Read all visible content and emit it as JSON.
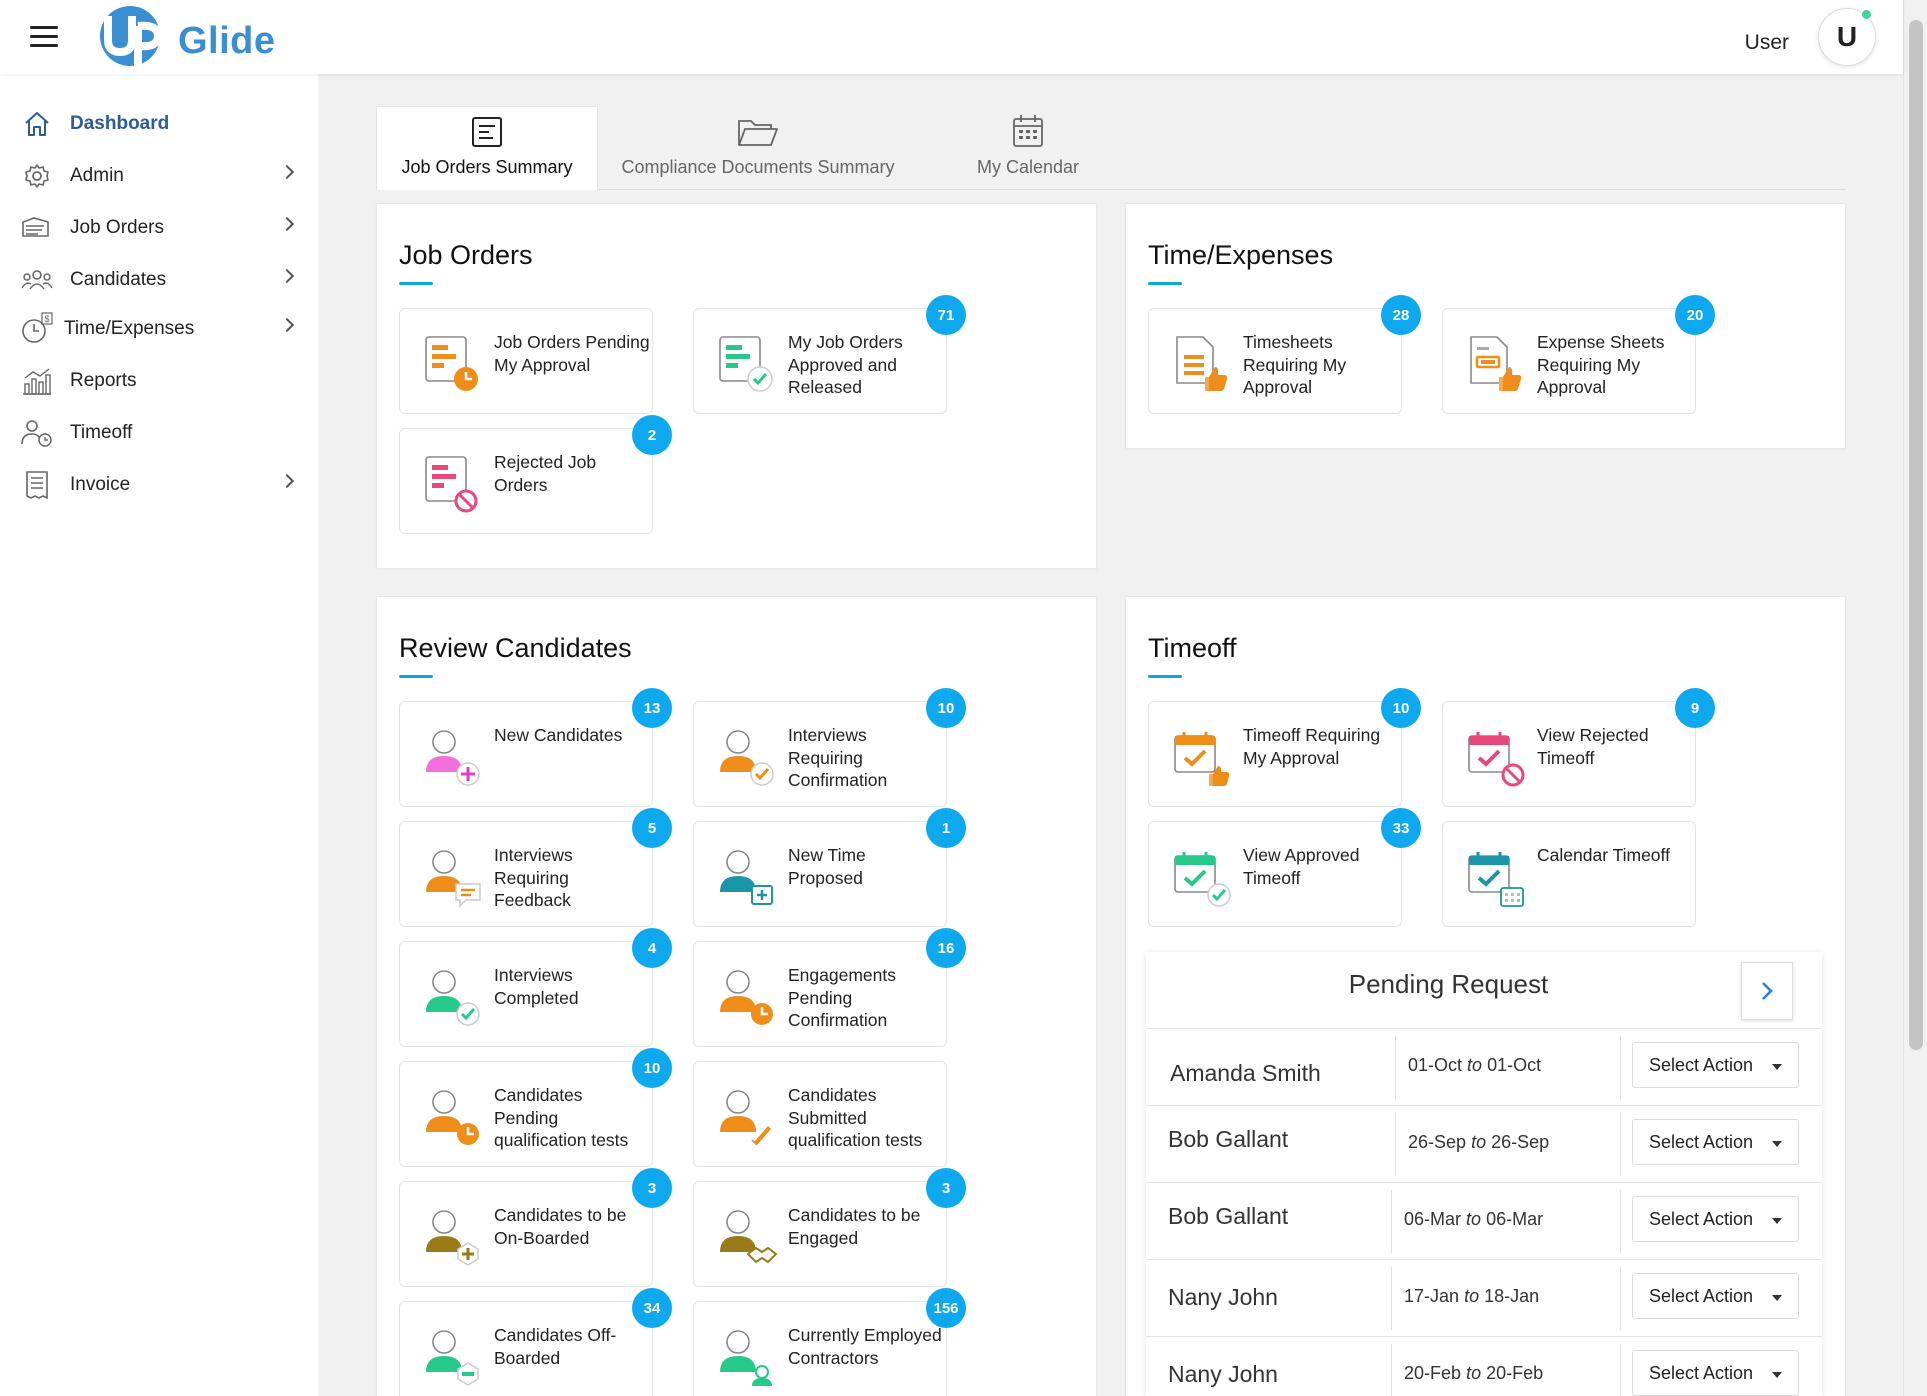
{
  "header": {
    "logo_text": "Glide",
    "logo_letters": "Up",
    "user_label": "User",
    "avatar_initial": "U"
  },
  "sidebar": {
    "items": [
      {
        "label": "Dashboard",
        "icon": "home-icon",
        "active": true,
        "has_submenu": false
      },
      {
        "label": "Admin",
        "icon": "gear-icon",
        "active": false,
        "has_submenu": true
      },
      {
        "label": "Job Orders",
        "icon": "job-orders-icon",
        "active": false,
        "has_submenu": true
      },
      {
        "label": "Candidates",
        "icon": "people-icon",
        "active": false,
        "has_submenu": true
      },
      {
        "label": "Time/Expenses",
        "icon": "clock-dollar-icon",
        "active": false,
        "has_submenu": true
      },
      {
        "label": "Reports",
        "icon": "chart-icon",
        "active": false,
        "has_submenu": false
      },
      {
        "label": "Timeoff",
        "icon": "person-clock-icon",
        "active": false,
        "has_submenu": false
      },
      {
        "label": "Invoice",
        "icon": "invoice-icon",
        "active": false,
        "has_submenu": true
      }
    ]
  },
  "tabs": [
    {
      "label": "Job Orders Summary",
      "icon": "document-list-icon",
      "active": true
    },
    {
      "label": "Compliance Documents Summary",
      "icon": "folder-open-icon",
      "active": false
    },
    {
      "label": "My Calendar",
      "icon": "calendar-icon",
      "active": false
    }
  ],
  "job_orders": {
    "title": "Job Orders",
    "tiles": [
      {
        "label": "Job Orders Pending My Approval",
        "badge": "",
        "icon": "job-pending-icon"
      },
      {
        "label": "My Job Orders Approved and Released",
        "badge": "71",
        "icon": "job-approved-icon"
      },
      {
        "label": "Rejected Job Orders",
        "badge": "2",
        "icon": "job-rejected-icon"
      }
    ]
  },
  "time_expenses": {
    "title": "Time/Expenses",
    "tiles": [
      {
        "label": "Timesheets Requiring My Approval",
        "badge": "28",
        "icon": "timesheet-approval-icon"
      },
      {
        "label": "Expense Sheets Requiring My Approval",
        "badge": "20",
        "icon": "expense-approval-icon"
      }
    ]
  },
  "review_candidates": {
    "title": "Review Candidates",
    "tiles": [
      {
        "label": "New Candidates",
        "badge": "13",
        "icon": "new-candidate-icon"
      },
      {
        "label": "Interviews Requiring Confirmation",
        "badge": "10",
        "icon": "interview-confirm-icon"
      },
      {
        "label": "Interviews Requiring Feedback",
        "badge": "5",
        "icon": "interview-feedback-icon"
      },
      {
        "label": "New Time Proposed",
        "badge": "1",
        "icon": "new-time-icon"
      },
      {
        "label": "Interviews Completed",
        "badge": "4",
        "icon": "interview-completed-icon"
      },
      {
        "label": "Engagements Pending Confirmation",
        "badge": "16",
        "icon": "engagement-pending-icon"
      },
      {
        "label": "Candidates Pending qualification tests",
        "badge": "10",
        "icon": "qualification-pending-icon"
      },
      {
        "label": "Candidates Submitted qualification tests",
        "badge": "",
        "icon": "qualification-submitted-icon"
      },
      {
        "label": "Candidates to be On-Boarded",
        "badge": "3",
        "icon": "onboard-icon"
      },
      {
        "label": "Candidates to be Engaged",
        "badge": "3",
        "icon": "engage-icon"
      },
      {
        "label": "Candidates Off-Boarded",
        "badge": "34",
        "icon": "offboard-icon"
      },
      {
        "label": "Currently Employed Contractors",
        "badge": "156",
        "icon": "contractor-icon"
      }
    ]
  },
  "timeoff": {
    "title": "Timeoff",
    "tiles": [
      {
        "label": "Timeoff Requiring My Approval",
        "badge": "10",
        "icon": "timeoff-approval-icon"
      },
      {
        "label": "View Rejected Timeoff",
        "badge": "9",
        "icon": "timeoff-rejected-icon"
      },
      {
        "label": "View Approved Timeoff",
        "badge": "33",
        "icon": "timeoff-approved-icon"
      },
      {
        "label": "Calendar Timeoff",
        "badge": "",
        "icon": "calendar-timeoff-icon"
      }
    ]
  },
  "pending_request": {
    "title": "Pending Request",
    "select_label": "Select Action",
    "to_word": "to",
    "rows": [
      {
        "name": "Amanda Smith",
        "from": "01-Oct",
        "to": "01-Oct"
      },
      {
        "name": "Bob Gallant",
        "from": "26-Sep",
        "to": "26-Sep"
      },
      {
        "name": "Bob Gallant",
        "from": "06-Mar",
        "to": "06-Mar"
      },
      {
        "name": "Nany John",
        "from": "17-Jan",
        "to": "18-Jan"
      },
      {
        "name": "Nany John",
        "from": "20-Feb",
        "to": "20-Feb"
      }
    ]
  },
  "colors": {
    "accent": "#0ea8ef",
    "brand": "#3a8fd3",
    "orange": "#ef8d1a",
    "green": "#27c98b",
    "pink": "#e8487b"
  }
}
